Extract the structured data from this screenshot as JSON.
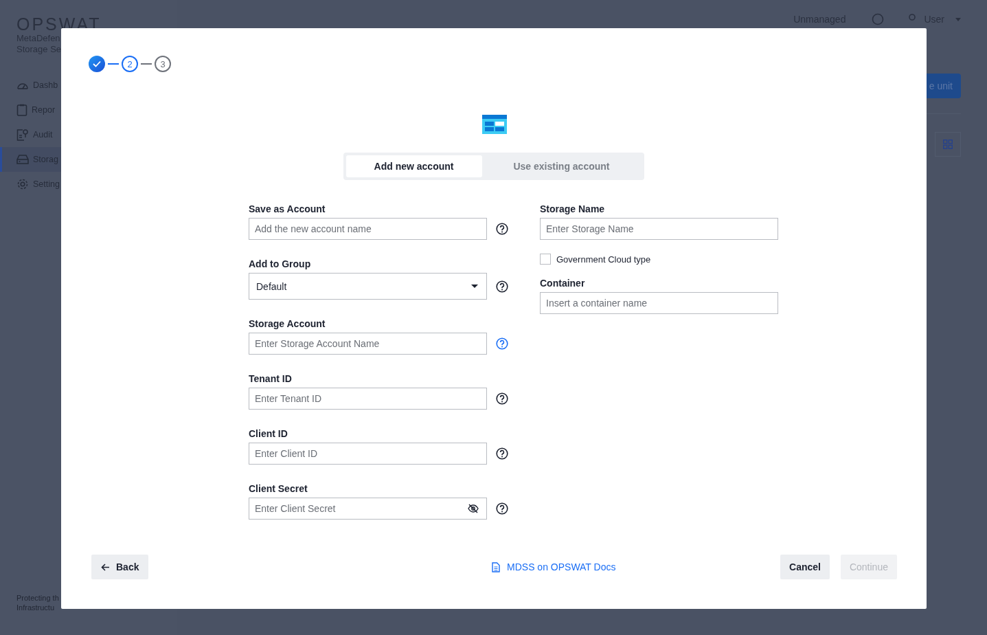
{
  "app": {
    "logo": "OPSWAT",
    "product_lines": [
      "MetaDefen",
      "Storage Se"
    ],
    "nav": [
      {
        "label": "Dashb",
        "selected": false
      },
      {
        "label": "Repor",
        "selected": false
      },
      {
        "label": "Audit",
        "selected": false
      },
      {
        "label": "Storag",
        "selected": true
      },
      {
        "label": "Setting",
        "selected": false
      }
    ],
    "footer_lines": [
      "Protecting th",
      "Infrastructu"
    ],
    "header": {
      "status": "Unmanaged",
      "user": "User"
    },
    "primary_button": "e unit"
  },
  "dialog": {
    "steps": [
      {
        "completed": true,
        "selected": false
      },
      {
        "label": "2",
        "completed": false,
        "selected": true
      },
      {
        "label": "3",
        "completed": false,
        "selected": false
      }
    ],
    "tabs": [
      {
        "label": "Add new account",
        "selected": true
      },
      {
        "label": "Use existing account",
        "selected": false
      }
    ],
    "left_fields": [
      {
        "kind": "text",
        "label": "Save as Account",
        "placeholder": "Add the new account name",
        "help_active": false
      },
      {
        "kind": "select",
        "label": "Add to Group",
        "value": "Default",
        "help_active": false
      },
      {
        "kind": "text",
        "label": "Storage Account",
        "placeholder": "Enter Storage Account Name",
        "help_active": true
      },
      {
        "kind": "text",
        "label": "Tenant ID",
        "placeholder": "Enter Tenant ID",
        "help_active": false
      },
      {
        "kind": "text",
        "label": "Client ID",
        "placeholder": "Enter Client ID",
        "help_active": false
      },
      {
        "kind": "secret",
        "label": "Client Secret",
        "placeholder": "Enter Client Secret",
        "help_active": false
      }
    ],
    "right_fields": [
      {
        "kind": "text",
        "label": "Storage Name",
        "placeholder": "Enter Storage Name"
      },
      {
        "kind": "checkbox",
        "label": "Government Cloud type",
        "checked": false
      },
      {
        "kind": "text",
        "label": "Container",
        "placeholder": "Insert a container name"
      }
    ],
    "footer": {
      "back": "Back",
      "docs_link": "MDSS on OPSWAT Docs",
      "cancel": "Cancel",
      "continue": {
        "label": "Continue",
        "disabled": true
      }
    }
  }
}
